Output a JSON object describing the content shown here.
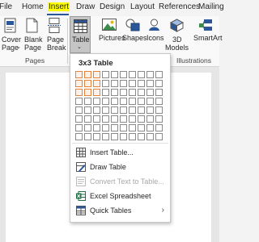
{
  "tabs": [
    "File",
    "Home",
    "Insert",
    "Draw",
    "Design",
    "Layout",
    "References",
    "Mailing"
  ],
  "ribbon": {
    "cover_page": [
      "Cover",
      "Page"
    ],
    "blank_page": [
      "Blank",
      "Page"
    ],
    "page_break": [
      "Page",
      "Break"
    ],
    "pages_group": "Pages",
    "table": "Table",
    "pictures": "Pictures",
    "shapes": "Shapes",
    "icons": "Icons",
    "models_3d": [
      "3D",
      "Models"
    ],
    "smartart": "SmartArt",
    "illustrations_group": "Illustrations"
  },
  "dropdown": {
    "title": "3x3 Table",
    "grid": {
      "columns": 10,
      "rows": 8,
      "selected_columns": 3,
      "selected_rows": 3
    },
    "items": [
      {
        "label": "Insert Table...",
        "icon": "table-grid-icon",
        "disabled": false
      },
      {
        "label": "Draw Table",
        "icon": "pencil-table-icon",
        "disabled": false
      },
      {
        "label": "Convert Text to Table...",
        "icon": "convert-text-icon",
        "disabled": true
      },
      {
        "label": "Excel Spreadsheet",
        "icon": "excel-icon",
        "disabled": false
      },
      {
        "label": "Quick Tables",
        "icon": "quick-tables-icon",
        "disabled": false,
        "submenu": true
      }
    ]
  },
  "colors": {
    "accent": "#2b579a",
    "highlight": "#ffff00",
    "selection": "#e8823b",
    "excel": "#1e7145"
  }
}
